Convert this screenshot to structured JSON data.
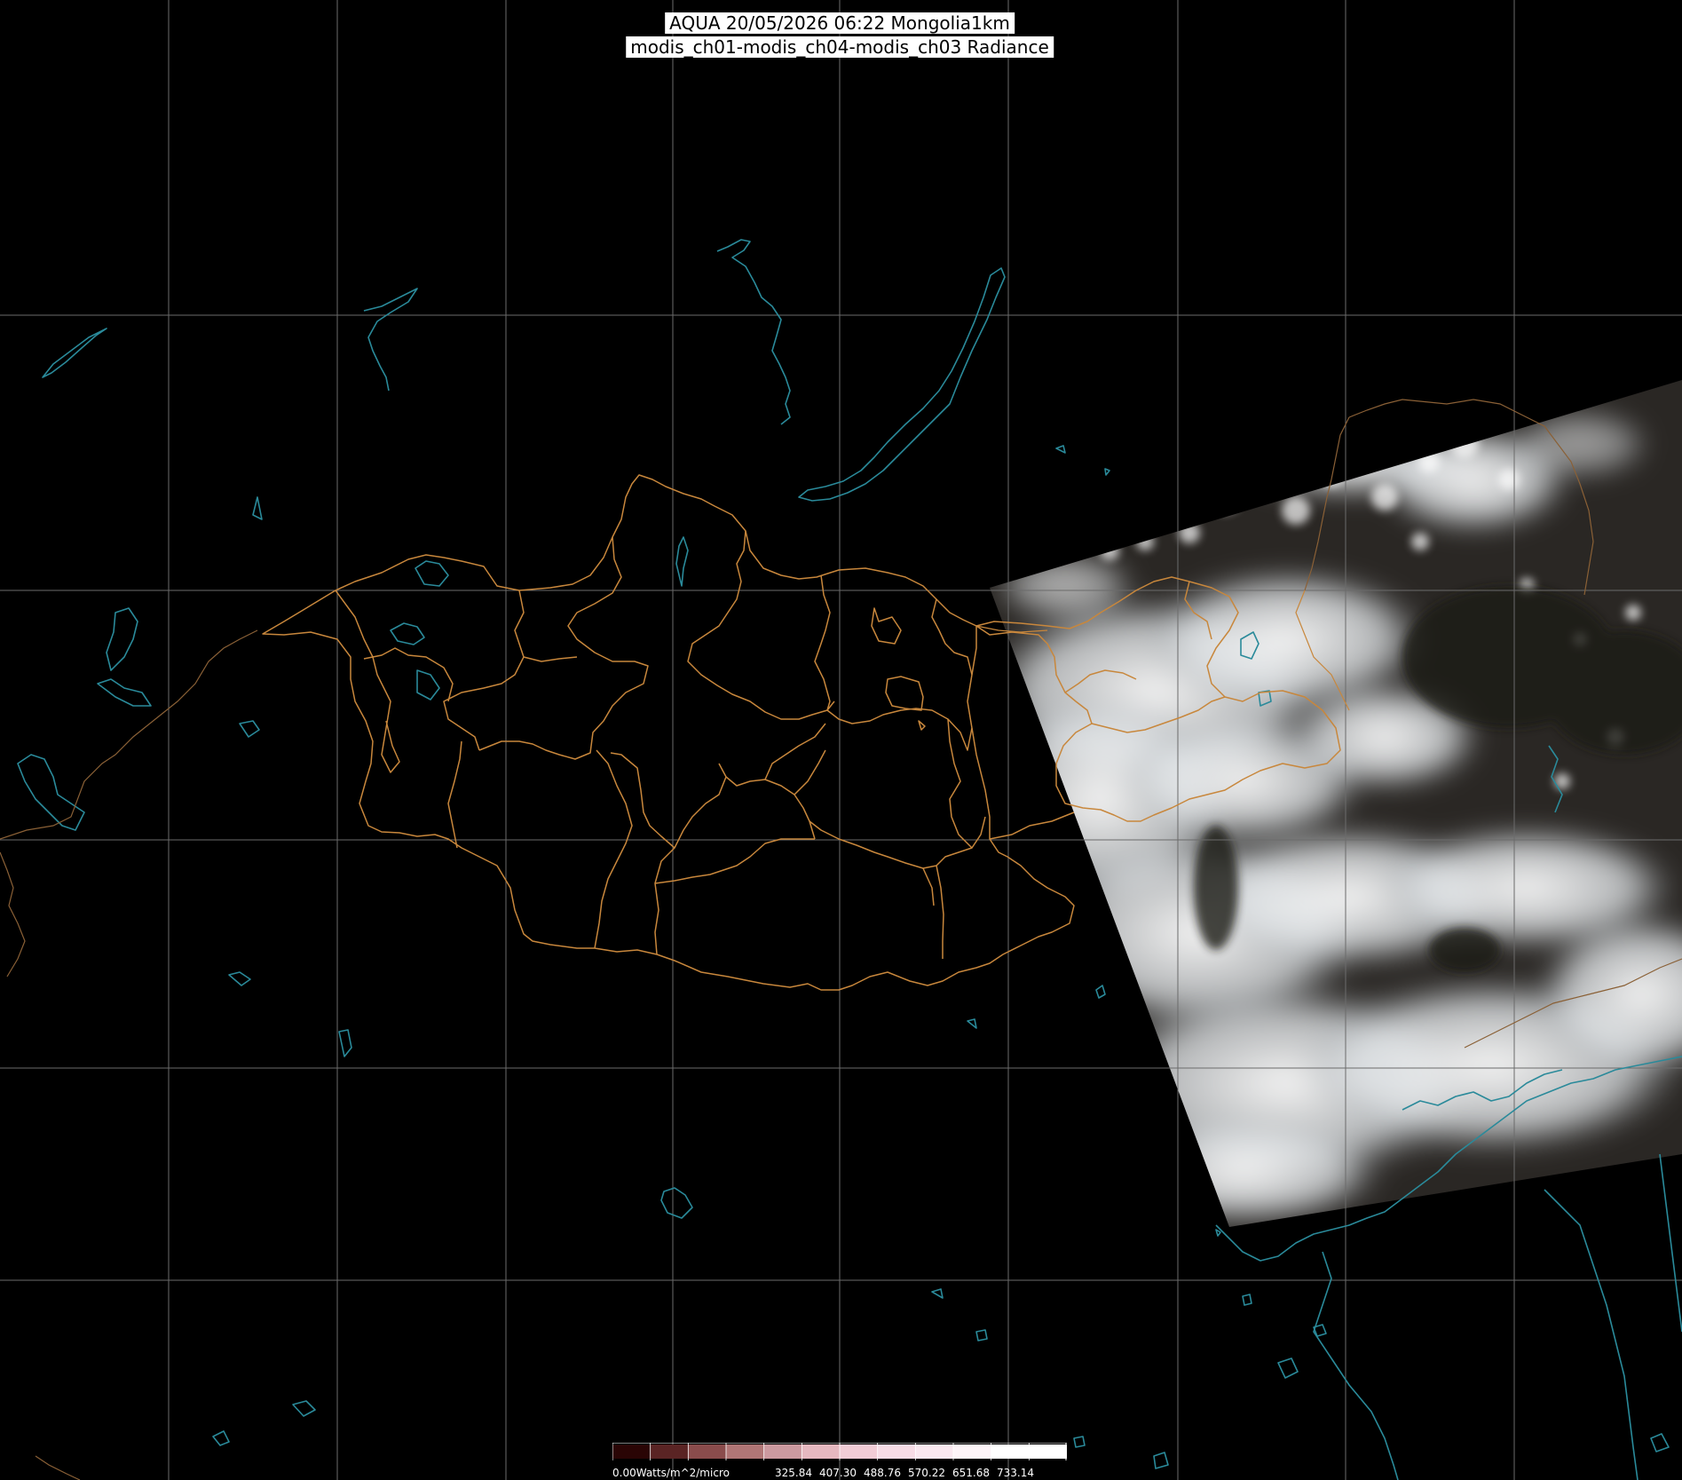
{
  "title": {
    "line1": "AQUA 20/05/2026 06:22 Mongolia1km",
    "line2": "modis_ch01-modis_ch04-modis_ch03 Radiance"
  },
  "colors": {
    "background": "#000000",
    "graticule": "#6b6b6b",
    "mongolia_borders": "#c8873c",
    "coastlines_lakes": "#2a8a9a",
    "cloud": "#eef0f2",
    "land": "#2a2724"
  },
  "legend": {
    "unit_label": "0.00Watts/m^2/micro",
    "tick_values": [
      "325.84",
      "407.30",
      "488.76",
      "570.22",
      "651.68",
      "733.14"
    ],
    "colors": [
      "#2a0505",
      "#5a2424",
      "#8a4c4c",
      "#b07676",
      "#cc9aa0",
      "#e6b8c0",
      "#f2ccd6",
      "#f7dce6",
      "#fae8f0",
      "#fdf4f8",
      "#ffffff",
      "#ffffff"
    ]
  }
}
